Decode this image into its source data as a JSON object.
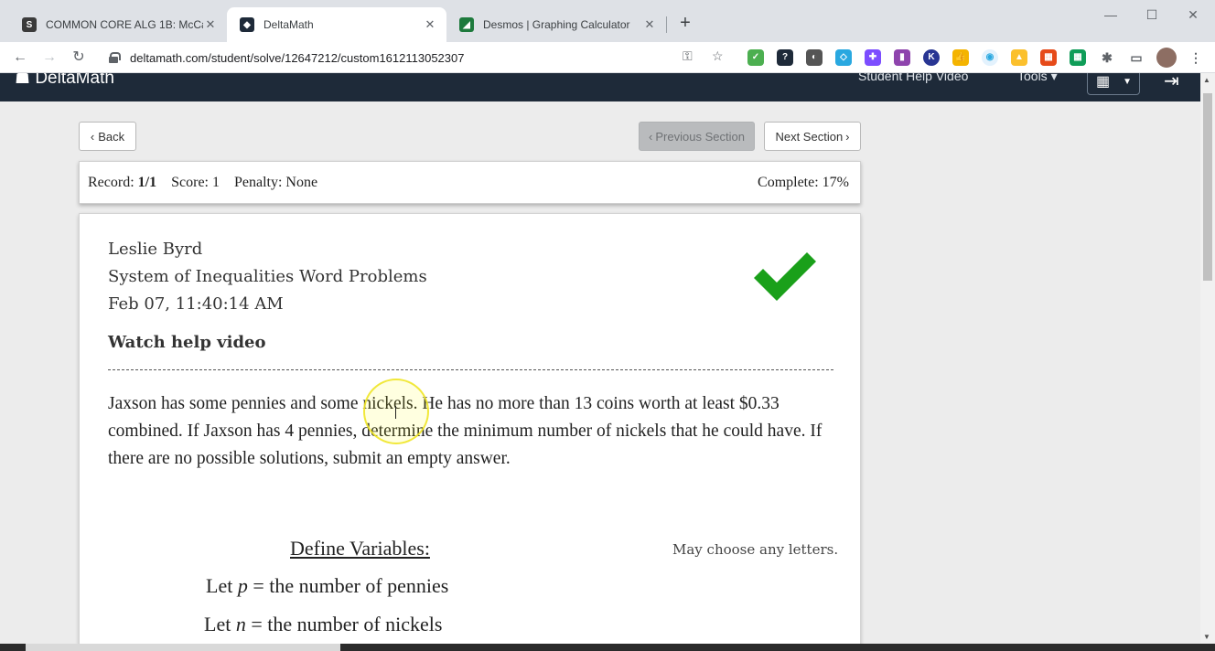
{
  "browser": {
    "tabs": [
      {
        "title": "COMMON CORE ALG 1B: McCarr",
        "favicon": "S",
        "color": "#3b3b3b",
        "active": false
      },
      {
        "title": "DeltaMath",
        "favicon": "◆",
        "color": "#1e2a39",
        "active": true
      },
      {
        "title": "Desmos | Graphing Calculator",
        "favicon": "◢",
        "color": "#1e7a3d",
        "active": false
      }
    ],
    "url": "deltamath.com/student/solve/12647212/custom1612113052307"
  },
  "header": {
    "logo": "DeltaMath",
    "help_video": "Student Help Video",
    "tools": "Tools ▾"
  },
  "nav": {
    "back": "Back",
    "previous": "Previous Section",
    "next": "Next Section"
  },
  "record": {
    "record_label": "Record:",
    "record_value": "1/1",
    "score": "Score: 1",
    "penalty": "Penalty: None",
    "complete": "Complete: 17%"
  },
  "problem": {
    "student": "Leslie Byrd",
    "assignment": "System of Inequalities Word Problems",
    "timestamp": "Feb 07, 11:40:14 AM",
    "help_link": "Watch help video",
    "text": "Jaxson has some pennies and some nickels. He has no more than 13 coins worth at least $0.33 combined. If Jaxson has 4 pennies, determine the minimum number of nickels that he could have. If there are no possible solutions, submit an empty answer.",
    "define_title": "Define Variables:",
    "choose_note": "May choose any letters.",
    "var1_prefix": "Let",
    "var1_letter": "p",
    "var1_rest": "= the number of pennies",
    "var2_prefix": "Let",
    "var2_letter": "n",
    "var2_rest": "= the number of nickels"
  },
  "colors": {
    "header_bg": "#1e2a39",
    "check_green": "#1aa01a"
  }
}
